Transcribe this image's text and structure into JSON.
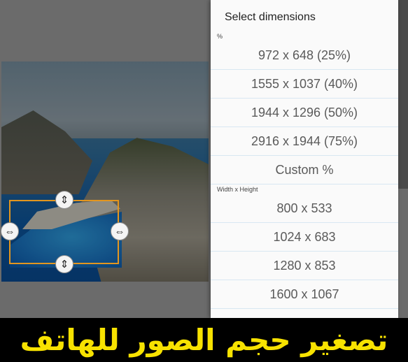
{
  "dialog": {
    "title": "Select dimensions",
    "percent_label": "%",
    "percent_options": [
      "972 x 648  (25%)",
      "1555 x 1037  (40%)",
      "1944 x 1296  (50%)",
      "2916 x 1944  (75%)"
    ],
    "custom_label": "Custom %",
    "size_label": "Width x Height",
    "size_options": [
      "800 x 533",
      "1024 x 683",
      "1280 x 853",
      "1600 x 1067"
    ]
  },
  "banner": {
    "text": "تصغير حجم الصور  للهاتف",
    "color": "#f7e200"
  },
  "colors": {
    "crop_border": "#e3961f",
    "dialog_bg": "#fafafa",
    "divider": "#d8e7f2"
  },
  "icons": {
    "vertical_handle": "up-down-arrow-icon",
    "horizontal_handle": "left-right-arrow-icon"
  }
}
